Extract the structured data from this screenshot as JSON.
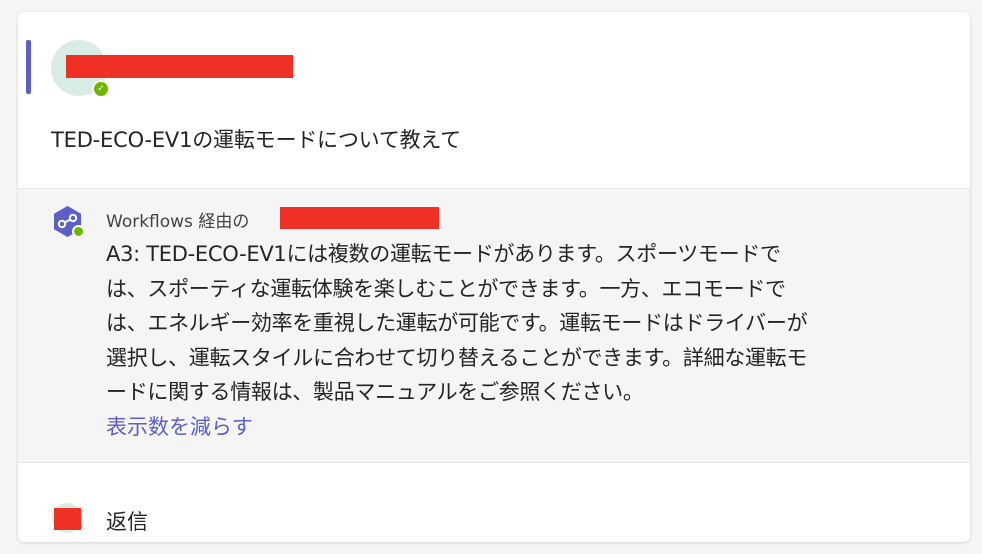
{
  "post": {
    "message": "TED-ECO-EV1の運転モードについて教えて"
  },
  "reply": {
    "via_label": "Workflows 経由の",
    "body_lines": [
      "A3: TED-ECO-EV1には複数の運転モードがあります。スポーツモードで",
      "は、スポーティな運転体験を楽しむことができます。一方、エコモードで",
      "は、エネルギー効率を重視した運転が可能です。運転モードはドライバーが",
      "選択し、運転スタイルに合わせて切り替えることができます。詳細な運転モ",
      "ードに関する情報は、製品マニュアルをご参照ください。"
    ],
    "show_less_label": "表示数を減らす"
  },
  "footer": {
    "reply_label": "返信"
  },
  "colors": {
    "accent": "#5b5fc7",
    "presence_available": "#6bb700",
    "redaction": "#ee3124"
  },
  "icons": {
    "bot_avatar": "workflows-icon",
    "presence": "check-icon"
  }
}
